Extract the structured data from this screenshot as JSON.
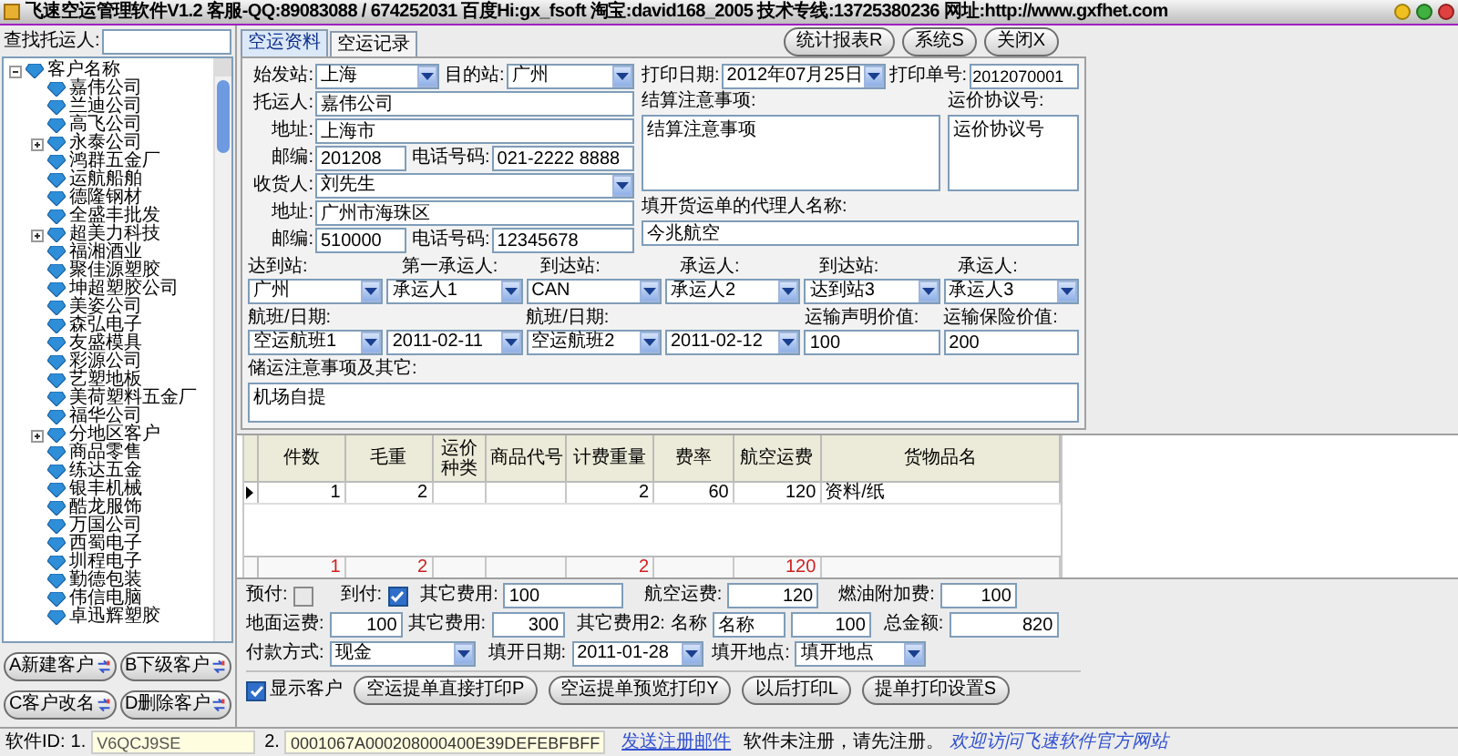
{
  "window": {
    "title": "飞速空运管理软件V1.2 客服-QQ:89083088 / 674252031 百度Hi:gx_fsoft 淘宝:david168_2005 技术专线:13725380236 网址:http://www.gxfhet.com"
  },
  "search": {
    "label": "查找托运人:"
  },
  "tree": {
    "label": "客户名称",
    "expanded": true,
    "children": [
      {
        "label": "嘉伟公司",
        "kind": "leaf"
      },
      {
        "label": "兰迪公司",
        "kind": "leaf"
      },
      {
        "label": "高飞公司",
        "kind": "leaf"
      },
      {
        "label": "永泰公司",
        "kind": "group",
        "expanded": false
      },
      {
        "label": "鸿群五金厂",
        "kind": "leaf"
      },
      {
        "label": "运航船舶",
        "kind": "leaf"
      },
      {
        "label": "德隆钢材",
        "kind": "leaf"
      },
      {
        "label": "全盛丰批发",
        "kind": "leaf"
      },
      {
        "label": "超美力科技",
        "kind": "group",
        "expanded": false
      },
      {
        "label": "福湘酒业",
        "kind": "leaf"
      },
      {
        "label": "聚佳源塑胶",
        "kind": "leaf"
      },
      {
        "label": "坤超塑胶公司",
        "kind": "leaf"
      },
      {
        "label": "美姿公司",
        "kind": "leaf"
      },
      {
        "label": "森弘电子",
        "kind": "leaf"
      },
      {
        "label": "友盛模具",
        "kind": "leaf"
      },
      {
        "label": "彩源公司",
        "kind": "leaf"
      },
      {
        "label": "艺塑地板",
        "kind": "leaf"
      },
      {
        "label": "美荷塑料五金厂",
        "kind": "leaf"
      },
      {
        "label": "福华公司",
        "kind": "leaf"
      },
      {
        "label": "分地区客户",
        "kind": "group",
        "expanded": false
      },
      {
        "label": "商品零售",
        "kind": "leaf"
      },
      {
        "label": "练达五金",
        "kind": "leaf"
      },
      {
        "label": "银丰机械",
        "kind": "leaf"
      },
      {
        "label": "酷龙服饰",
        "kind": "leaf"
      },
      {
        "label": "万国公司",
        "kind": "leaf"
      },
      {
        "label": "西蜀电子",
        "kind": "leaf"
      },
      {
        "label": "圳程电子",
        "kind": "leaf"
      },
      {
        "label": "勤德包装",
        "kind": "leaf"
      },
      {
        "label": "伟信电脑",
        "kind": "leaf"
      },
      {
        "label": "卓迅辉塑胶",
        "kind": "leaf"
      }
    ]
  },
  "customer_buttons": [
    "A新建客户",
    "B下级客户",
    "C客户改名",
    "D删除客户"
  ],
  "tabs": [
    {
      "label": "空运资料",
      "selected": true
    },
    {
      "label": "空运记录",
      "selected": false
    }
  ],
  "toolbar": [
    "统计报表R",
    "系统S",
    "关闭X"
  ],
  "route": {
    "origin": {
      "label": "始发站:",
      "value": "上海"
    },
    "destination": {
      "label": "目的站:",
      "value": "广州"
    }
  },
  "print": {
    "date": {
      "label": "打印日期:",
      "value": "2012年07月25日"
    },
    "number": {
      "label": "打印单号:",
      "value": "2012070001"
    }
  },
  "shipper": {
    "label": "托运人:",
    "name": "嘉伟公司",
    "address_label": "地址:",
    "address": "上海市",
    "zip_label": "邮编:",
    "zip": "201208",
    "phone_label": "电话号码:",
    "phone": "021-2222 8888"
  },
  "consignee": {
    "label": "收货人:",
    "name": "刘先生",
    "address_label": "地址:",
    "address": "广州市海珠区",
    "zip_label": "邮编:",
    "zip": "510000",
    "phone_label": "电话号码:",
    "phone": "12345678"
  },
  "settlement": {
    "label": "结算注意事项:",
    "value": "结算注意事项"
  },
  "rate_agreement": {
    "label": "运价协议号:",
    "value": "运价协议号"
  },
  "agent": {
    "label": "填开货运单的代理人名称:",
    "value": "今兆航空"
  },
  "legs": [
    {
      "label": "达到站:",
      "value": "广州",
      "kind": "select"
    },
    {
      "label": "第一承运人:",
      "value": "承运人1",
      "kind": "select"
    },
    {
      "label": "到达站:",
      "value": "CAN",
      "kind": "select"
    },
    {
      "label": "承运人:",
      "value": "承运人2",
      "kind": "select"
    },
    {
      "label": "到达站:",
      "value": "达到站3",
      "kind": "select"
    },
    {
      "label": "承运人:",
      "value": "承运人3",
      "kind": "select"
    }
  ],
  "flights": [
    {
      "label": "航班/日期:",
      "value": "空运航班1",
      "kind": "select"
    },
    {
      "value": "2011-02-11",
      "kind": "select"
    },
    {
      "label": "航班/日期:",
      "value": "空运航班2",
      "kind": "select"
    },
    {
      "value": "2011-02-12",
      "kind": "select"
    },
    {
      "label": "运输声明价值:",
      "value": "100",
      "kind": "input"
    },
    {
      "label": "运输保险价值:",
      "value": "200",
      "kind": "input"
    }
  ],
  "handling": {
    "label": "储运注意事项及其它:",
    "value": "机场自提"
  },
  "table": {
    "columns": [
      "件数",
      "毛重",
      "运价种类",
      "商品代号",
      "计费重量",
      "费率",
      "航空运费",
      "货物品名"
    ],
    "rows": [
      {
        "selected": true,
        "cells": {
          "column_1": "1",
          "column_2": "2",
          "column_5": "2",
          "column_6": "60",
          "column_7": "120",
          "column_8": "资料/纸"
        }
      }
    ],
    "totals": {
      "column_1": "1",
      "column_2": "2",
      "column_5": "2",
      "column_7": "120"
    }
  },
  "charges": {
    "prepaid": {
      "label": "预付:",
      "checked": false
    },
    "collect": {
      "label": "到付:",
      "checked": true
    },
    "other": {
      "label": "其它费用:",
      "value": "100"
    },
    "air": {
      "label": "航空运费:",
      "value": "120"
    },
    "fuel": {
      "label": "燃油附加费:",
      "value": "100"
    },
    "ground": {
      "label": "地面运费:",
      "value": "100"
    },
    "other1": {
      "label": "其它费用:",
      "value": "300"
    },
    "other2": {
      "label": "其它费用2:",
      "name_label": "名称",
      "name": "名称",
      "value": "100"
    },
    "total": {
      "label": "总金额:",
      "value": "820"
    },
    "payment": {
      "label": "付款方式:",
      "value": "现金"
    },
    "issue_date": {
      "label": "填开日期:",
      "value": "2011-01-28"
    },
    "issue_place": {
      "label": "填开地点:",
      "value": "填开地点"
    }
  },
  "show_customers": {
    "label": "显示客户",
    "checked": true
  },
  "print_buttons": [
    "空运提单直接打印P",
    "空运提单预览打印Y",
    "以后打印L",
    "提单打印设置S"
  ],
  "status_bar": {
    "id_label": "软件ID:",
    "id1_label": "1.",
    "id1": "V6QCJ9SE",
    "id2_label": "2.",
    "id2": "0001067A000208000400E39DEFEBFBFF",
    "register_link": "发送注册邮件",
    "notice": "软件未注册，请先注册。",
    "website_link": "欢迎访问飞速软件官方网站"
  }
}
